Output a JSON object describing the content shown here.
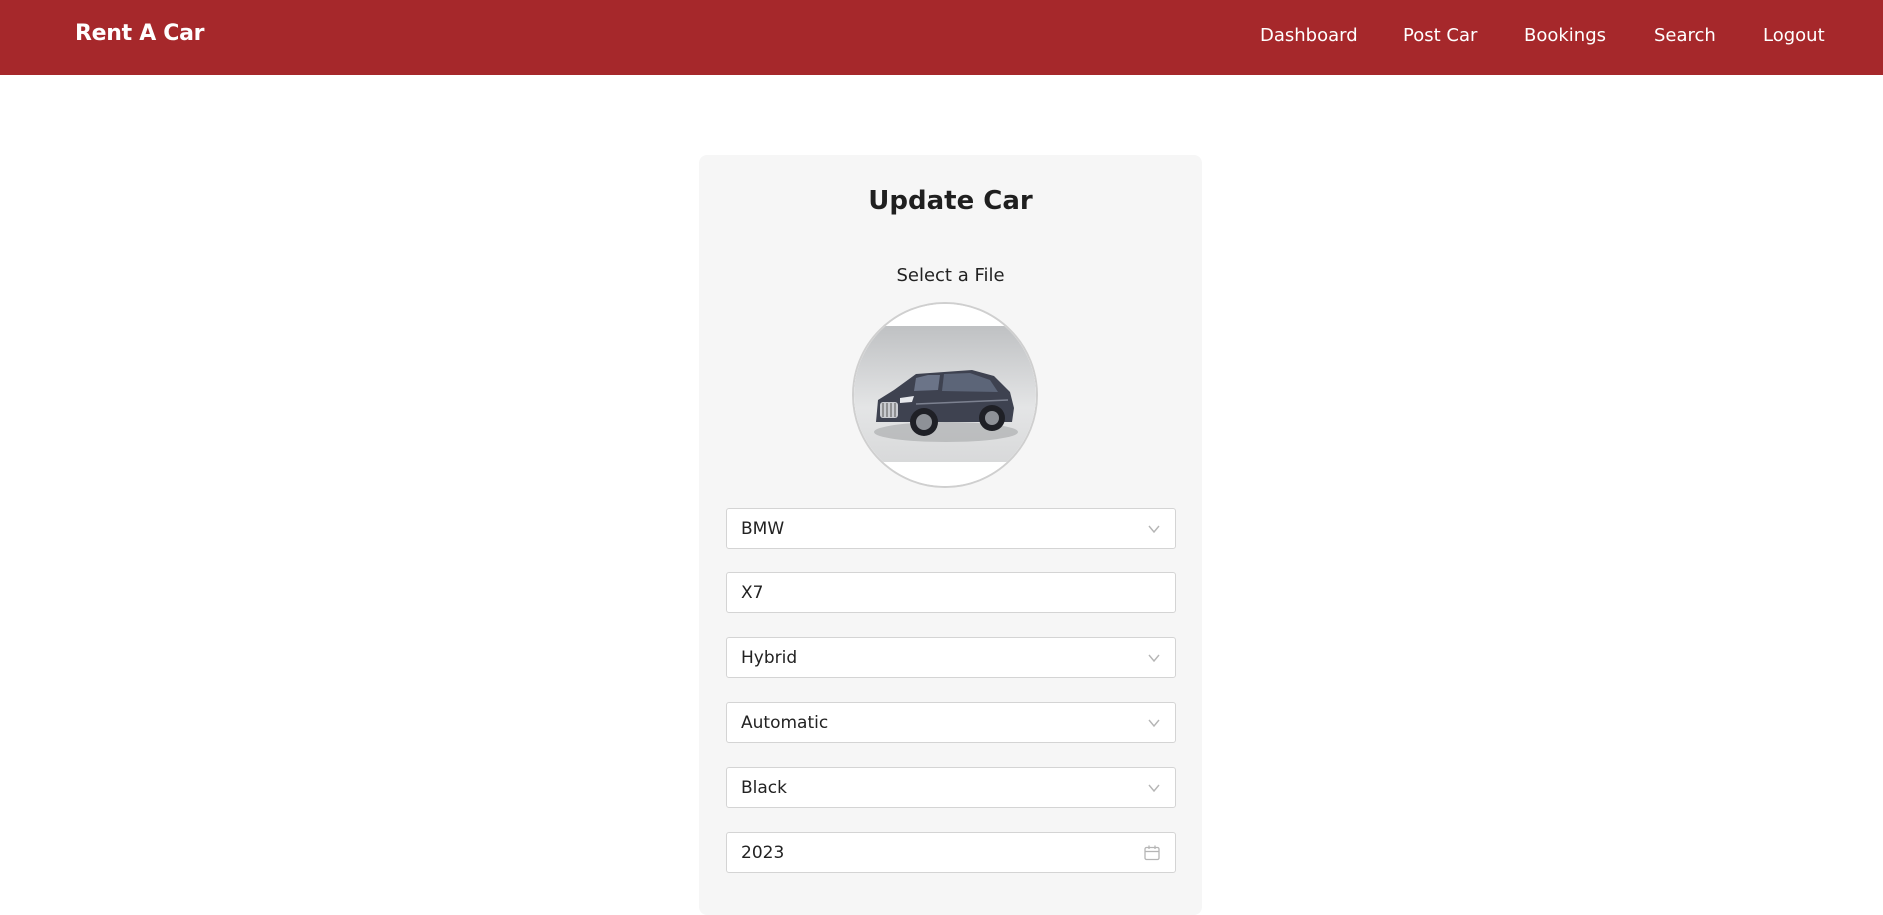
{
  "navbar": {
    "brand": "Rent A Car",
    "links": [
      "Dashboard",
      "Post Car",
      "Bookings",
      "Search",
      "Logout"
    ],
    "background": "#a6282b"
  },
  "form": {
    "title": "Update Car",
    "file_label": "Select a File",
    "image_icon": "car-photo",
    "brand": "BMW",
    "name": "X7",
    "fuel_type": "Hybrid",
    "transmission": "Automatic",
    "color": "Black",
    "year": "2023"
  }
}
